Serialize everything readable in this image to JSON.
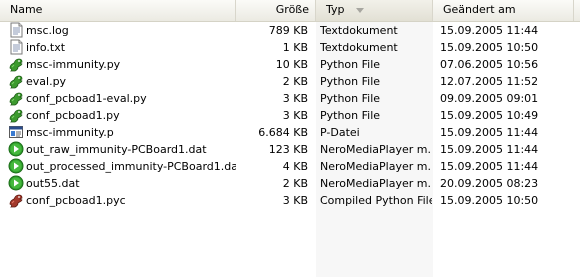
{
  "columns": {
    "name": "Name",
    "size": "Größe",
    "type": "Typ",
    "modified": "Geändert am"
  },
  "files": [
    {
      "name": "msc.log",
      "size": "789 KB",
      "type": "Textdokument",
      "modified": "15.09.2005 11:44",
      "icon": "text-document-icon"
    },
    {
      "name": "info.txt",
      "size": "1 KB",
      "type": "Textdokument",
      "modified": "15.09.2005 10:50",
      "icon": "text-document-icon"
    },
    {
      "name": "msc-immunity.py",
      "size": "10 KB",
      "type": "Python File",
      "modified": "07.06.2005 10:56",
      "icon": "python-file-icon"
    },
    {
      "name": "eval.py",
      "size": "2 KB",
      "type": "Python File",
      "modified": "12.07.2005 11:52",
      "icon": "python-file-icon"
    },
    {
      "name": "conf_pcboad1-eval.py",
      "size": "3 KB",
      "type": "Python File",
      "modified": "09.09.2005 09:01",
      "icon": "python-file-icon"
    },
    {
      "name": "conf_pcboad1.py",
      "size": "3 KB",
      "type": "Python File",
      "modified": "15.09.2005 10:49",
      "icon": "python-file-icon"
    },
    {
      "name": "msc-immunity.p",
      "size": "6.684 KB",
      "type": "P-Datei",
      "modified": "15.09.2005 11:44",
      "icon": "generic-file-icon"
    },
    {
      "name": "out_raw_immunity-PCBoard1.dat",
      "size": "123 KB",
      "type": "NeroMediaPlayer m...",
      "modified": "15.09.2005 11:44",
      "icon": "media-play-icon"
    },
    {
      "name": "out_processed_immunity-PCBoard1.dat",
      "size": "4 KB",
      "type": "NeroMediaPlayer m...",
      "modified": "15.09.2005 11:44",
      "icon": "media-play-icon"
    },
    {
      "name": "out55.dat",
      "size": "2 KB",
      "type": "NeroMediaPlayer m...",
      "modified": "20.09.2005 08:23",
      "icon": "media-play-icon"
    },
    {
      "name": "conf_pcboad1.pyc",
      "size": "3 KB",
      "type": "Compiled Python File",
      "modified": "15.09.2005 10:50",
      "icon": "compiled-python-icon"
    }
  ]
}
